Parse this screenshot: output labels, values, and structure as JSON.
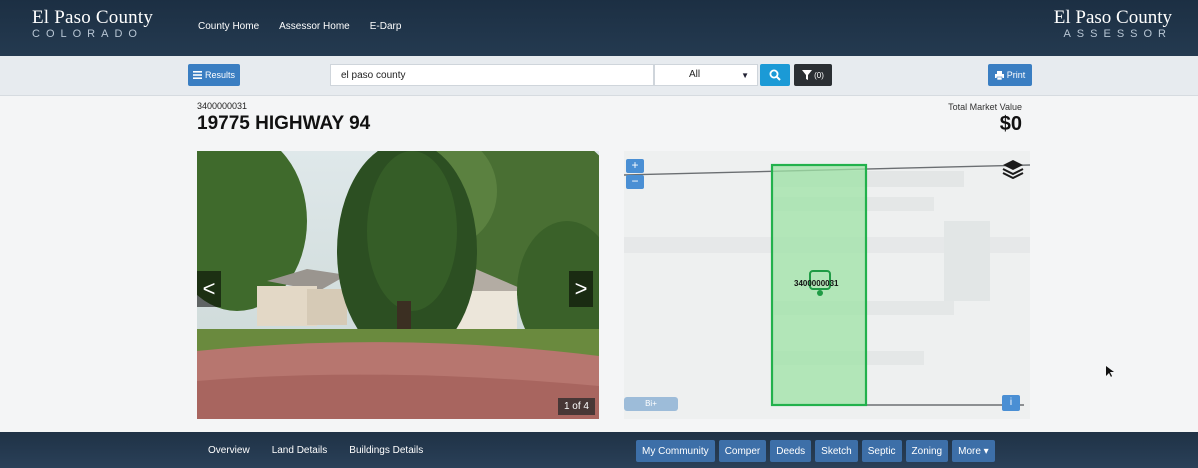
{
  "header": {
    "brand_name": "El Paso County",
    "brand_sub": "COLORADO",
    "right_brand_name": "El Paso County",
    "right_brand_sub": "ASSESSOR",
    "nav": [
      "County Home",
      "Assessor Home",
      "E-Darp"
    ]
  },
  "toolbar": {
    "results_label": "Results",
    "search_value": "el paso county",
    "filter_select": "All",
    "filter_count": "(0)",
    "print_label": "Print"
  },
  "property": {
    "parcel_id": "3400000031",
    "address": "19775 HIGHWAY 94",
    "tmv_label": "Total Market Value",
    "tmv_value": "$0"
  },
  "photo": {
    "counter": "1 of 4",
    "prev": "<",
    "next": ">"
  },
  "map": {
    "zoom_in": "+",
    "zoom_out": "−",
    "parcel_label": "3400000031",
    "scale_label": "Bi+",
    "info": "i"
  },
  "bottom": {
    "tabs": [
      "Overview",
      "Land Details",
      "Buildings Details"
    ],
    "actions": [
      "My Community",
      "Comper",
      "Deeds",
      "Sketch",
      "Septic",
      "Zoning",
      "More ▾"
    ]
  },
  "colors": {
    "header_bg": "#1c2f43",
    "accent_blue": "#3a7ec2",
    "search_blue": "#1b9ad6",
    "parcel_green": "#22b14c"
  }
}
